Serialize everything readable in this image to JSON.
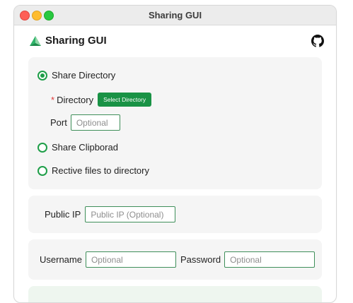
{
  "window": {
    "title": "Sharing GUI"
  },
  "app": {
    "title": "Sharing GUI",
    "logo_icon": "triangle-logo-icon",
    "github_icon": "github-icon",
    "accent_color": "#1e9e48"
  },
  "mode": {
    "options": [
      {
        "label": "Share Directory",
        "selected": true
      },
      {
        "label": "Share Clipborad",
        "selected": false
      },
      {
        "label": "Rective files to directory",
        "selected": false
      }
    ],
    "directory": {
      "required_mark": "*",
      "label": "Directory",
      "button_label": "Select Directory"
    },
    "port": {
      "label": "Port",
      "placeholder": "Optional",
      "value": ""
    }
  },
  "network": {
    "public_ip_label": "Public IP",
    "public_ip_placeholder": "Public IP (Optional)",
    "public_ip_value": ""
  },
  "auth": {
    "username_label": "Username",
    "username_placeholder": "Optional",
    "password_label": "Password",
    "password_placeholder": "Optional"
  }
}
